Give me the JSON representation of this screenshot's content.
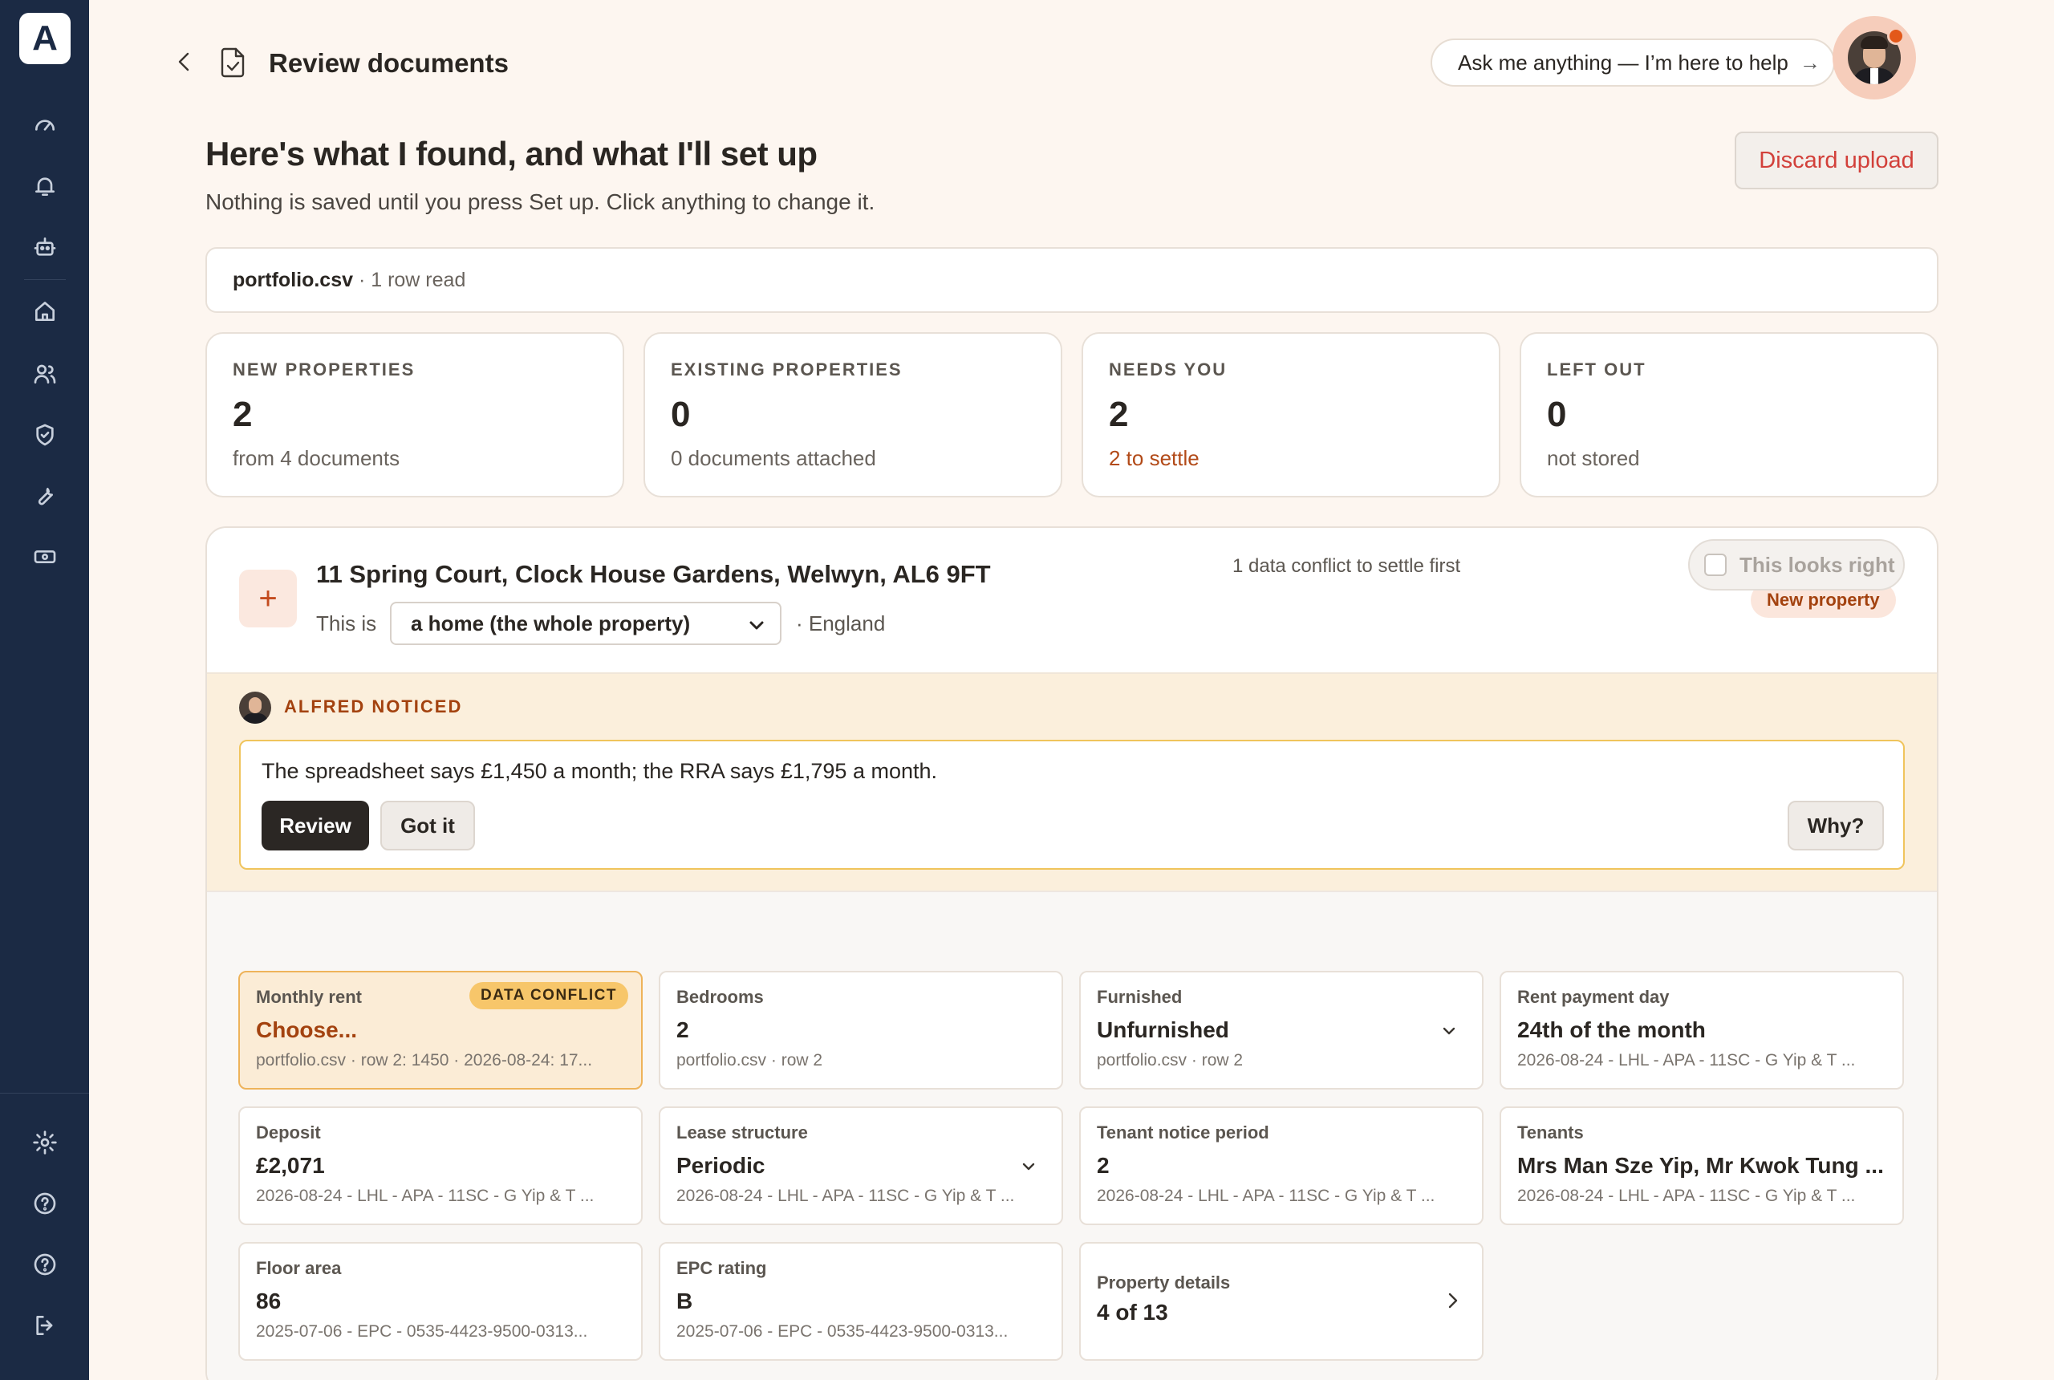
{
  "app": {
    "logo_letter": "A"
  },
  "sidebar": {
    "top_icons": [
      "dashboard-icon",
      "bell-icon",
      "robot-icon",
      "home-icon",
      "users-icon",
      "shield-check-icon",
      "wrench-icon",
      "money-icon"
    ],
    "bottom_icons": [
      "settings-icon",
      "help-icon",
      "help-icon",
      "logout-icon"
    ]
  },
  "header": {
    "title": "Review documents",
    "ask_label": "Ask me anything — I’m here to help",
    "ask_arrow": "→"
  },
  "intro": {
    "headline": "Here's what I found, and what I'll set up",
    "subline": "Nothing is saved until you press Set up. Click anything to change it.",
    "discard_label": "Discard upload"
  },
  "file": {
    "name": "portfolio.csv",
    "info": " · 1 row read"
  },
  "stats": [
    {
      "label": "NEW PROPERTIES",
      "value": "2",
      "sub": "from 4 documents"
    },
    {
      "label": "EXISTING PROPERTIES",
      "value": "0",
      "sub": "0 documents attached"
    },
    {
      "label": "NEEDS YOU",
      "value": "2",
      "sub": "2 to settle"
    },
    {
      "label": "LEFT OUT",
      "value": "0",
      "sub": "not stored"
    }
  ],
  "property": {
    "plus": "+",
    "address": "11 Spring Court, Clock House Gardens, Welwyn, AL6 9FT",
    "this_is": "This is",
    "type_selected": "a home (the whole property)",
    "region": "· England",
    "badge": "New property"
  },
  "notice": {
    "label": "ALFRED NOTICED",
    "text": "The spreadsheet says £1,450 a month; the RRA says £1,795 a month.",
    "review_label": "Review",
    "gotit_label": "Got it",
    "why_label": "Why?"
  },
  "fields_header": {
    "conflict_note": "1 data conflict to settle first",
    "looks_right_label": "This looks right"
  },
  "fields": [
    {
      "label": "Monthly rent",
      "value": "Choose...",
      "source": "portfolio.csv · row 2: 1450 · 2026-08-24: 17...",
      "badge": "DATA CONFLICT"
    },
    {
      "label": "Bedrooms",
      "value": "2",
      "source": "portfolio.csv · row 2"
    },
    {
      "label": "Furnished",
      "value": "Unfurnished",
      "source": "portfolio.csv · row 2"
    },
    {
      "label": "Rent payment day",
      "value": "24th of the month",
      "source": "2026-08-24 - LHL - APA - 11SC - G Yip & T ..."
    },
    {
      "label": "Deposit",
      "value": "£2,071",
      "source": "2026-08-24 - LHL - APA - 11SC - G Yip & T ..."
    },
    {
      "label": "Lease structure",
      "value": "Periodic",
      "source": "2026-08-24 - LHL - APA - 11SC - G Yip & T ..."
    },
    {
      "label": "Tenant notice period",
      "value": "2",
      "source": "2026-08-24 - LHL - APA - 11SC - G Yip & T ..."
    },
    {
      "label": "Tenants",
      "value": "Mrs Man Sze Yip, Mr Kwok Tung ...",
      "source": "2026-08-24 - LHL - APA - 11SC - G Yip & T ..."
    },
    {
      "label": "Floor area",
      "value": "86",
      "source": "2025-07-06 - EPC - 0535-4423-9500-0313..."
    },
    {
      "label": "EPC rating",
      "value": "B",
      "source": "2025-07-06 - EPC - 0535-4423-9500-0313..."
    },
    {
      "label": "Property details",
      "value": "4 of 13"
    }
  ],
  "colors": {
    "sidebar": "#1b2a44",
    "accent": "#c34b1e",
    "warning": "#b24a18",
    "danger": "#d2403a",
    "conflict_bg": "#fbecd6",
    "notice_border": "#f0c45c"
  }
}
